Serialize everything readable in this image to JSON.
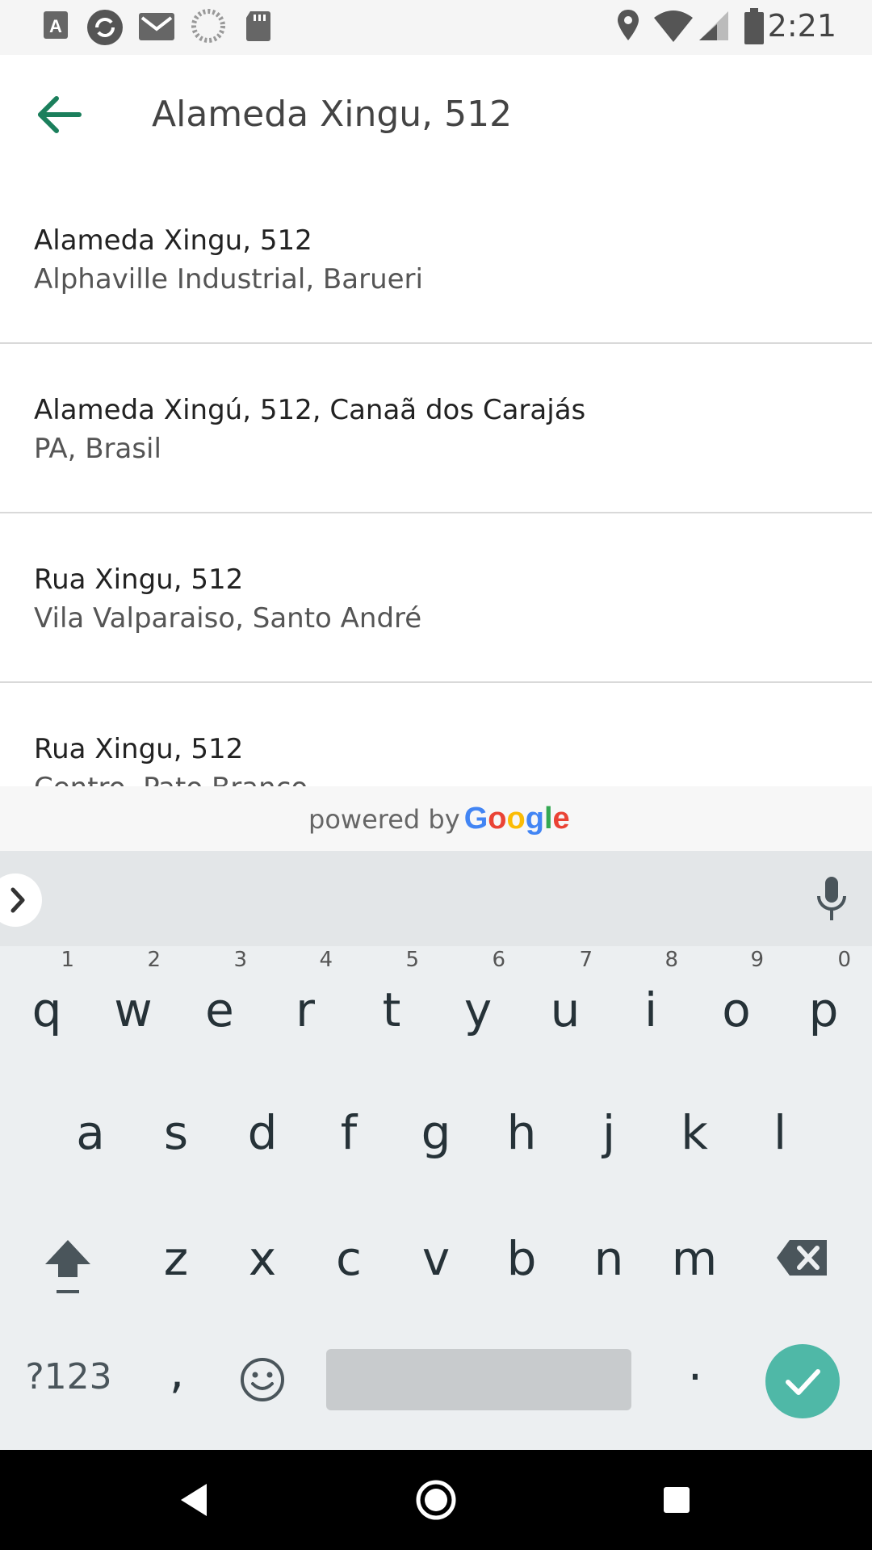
{
  "status_bar": {
    "time": "2:21",
    "left_icons": [
      "text-a-icon",
      "sync-icon",
      "mail-icon",
      "loading-circle-icon",
      "sd-card-icon"
    ],
    "right_icons": [
      "location-pin-icon",
      "wifi-icon",
      "cellular-signal-icon",
      "battery-icon"
    ]
  },
  "app_bar": {
    "search_value": "Alameda Xingu, 512"
  },
  "results": [
    {
      "primary": "Alameda Xingu, 512",
      "secondary": "Alphaville Industrial, Barueri"
    },
    {
      "primary": "Alameda Xingú, 512, Canaã dos Carajás",
      "secondary": "PA, Brasil"
    },
    {
      "primary": "Rua Xingu, 512",
      "secondary": "Vila Valparaiso, Santo André"
    },
    {
      "primary": "Rua Xingu, 512",
      "secondary": "Centro, Pato Branco"
    }
  ],
  "attribution": {
    "prefix": "powered by",
    "brand_letters": [
      "G",
      "o",
      "o",
      "g",
      "l",
      "e"
    ],
    "brand_colors": [
      "#4285F4",
      "#EA4335",
      "#FBBC05",
      "#4285F4",
      "#34A853",
      "#EA4335"
    ]
  },
  "keyboard": {
    "row1": [
      {
        "key": "q",
        "hint": "1"
      },
      {
        "key": "w",
        "hint": "2"
      },
      {
        "key": "e",
        "hint": "3"
      },
      {
        "key": "r",
        "hint": "4"
      },
      {
        "key": "t",
        "hint": "5"
      },
      {
        "key": "y",
        "hint": "6"
      },
      {
        "key": "u",
        "hint": "7"
      },
      {
        "key": "i",
        "hint": "8"
      },
      {
        "key": "o",
        "hint": "9"
      },
      {
        "key": "p",
        "hint": "0"
      }
    ],
    "row2": [
      "a",
      "s",
      "d",
      "f",
      "g",
      "h",
      "j",
      "k",
      "l"
    ],
    "row3": [
      "z",
      "x",
      "c",
      "v",
      "b",
      "n",
      "m"
    ],
    "symbols_label": "?123",
    "comma": ",",
    "period": ".",
    "colors": {
      "accent": "#4fb8a7",
      "background": "#eceff1"
    }
  },
  "nav_bar": {
    "buttons": [
      "back-triangle-icon",
      "home-circle-icon",
      "recents-square-icon"
    ]
  }
}
